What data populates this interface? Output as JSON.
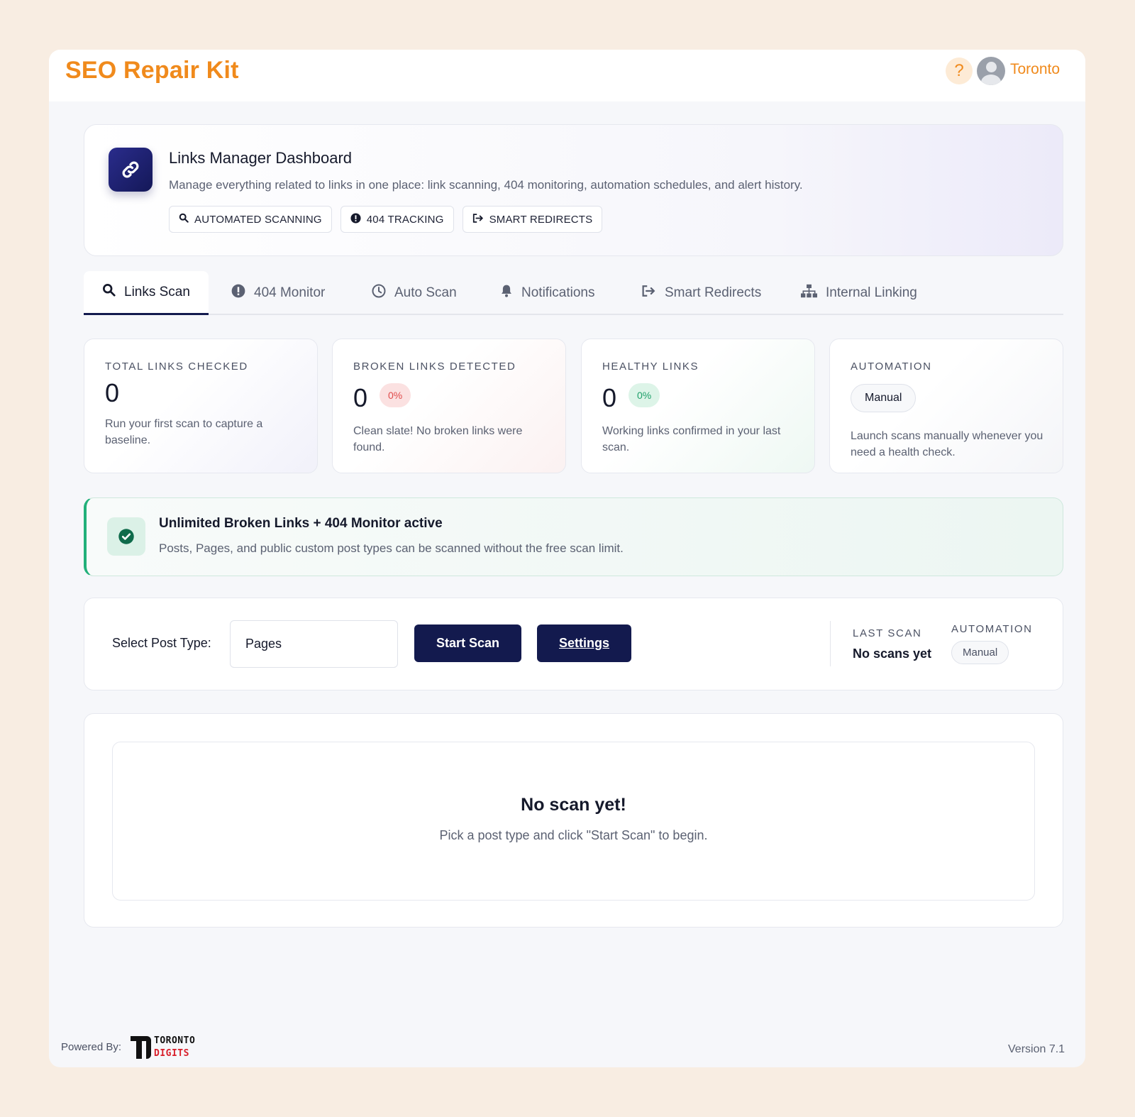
{
  "header": {
    "brand": "SEO Repair Kit",
    "help_label": "?",
    "user_name": "Toronto"
  },
  "hero": {
    "title": "Links Manager Dashboard",
    "description": "Manage everything related to links in one place: link scanning, 404 monitoring, automation schedules, and alert history.",
    "icon": "link-icon",
    "chips": [
      {
        "label": "AUTOMATED SCANNING",
        "icon": "search-icon"
      },
      {
        "label": "404 TRACKING",
        "icon": "alert-circle-icon"
      },
      {
        "label": "SMART REDIRECTS",
        "icon": "redirect-icon"
      }
    ]
  },
  "tabs": [
    {
      "label": "Links Scan",
      "icon": "search-icon",
      "active": true
    },
    {
      "label": "404 Monitor",
      "icon": "alert-circle-icon",
      "active": false
    },
    {
      "label": "Auto Scan",
      "icon": "clock-icon",
      "active": false
    },
    {
      "label": "Notifications",
      "icon": "bell-icon",
      "active": false
    },
    {
      "label": "Smart Redirects",
      "icon": "redirect-icon",
      "active": false
    },
    {
      "label": "Internal Linking",
      "icon": "sitemap-icon",
      "active": false
    }
  ],
  "stats": {
    "total": {
      "label": "TOTAL LINKS CHECKED",
      "value": "0",
      "description": "Run your first scan to capture a baseline."
    },
    "broken": {
      "label": "BROKEN LINKS DETECTED",
      "value": "0",
      "percent": "0%",
      "description": "Clean slate! No broken links were found."
    },
    "healthy": {
      "label": "HEALTHY LINKS",
      "value": "0",
      "percent": "0%",
      "description": "Working links confirmed in your last scan."
    },
    "automation": {
      "label": "AUTOMATION",
      "mode": "Manual",
      "description": "Launch scans manually whenever you need a health check."
    }
  },
  "banner": {
    "title": "Unlimited Broken Links + 404 Monitor active",
    "description": "Posts, Pages, and public custom post types can be scanned without the free scan limit.",
    "icon": "check-circle-icon"
  },
  "controls": {
    "select_label": "Select Post Type:",
    "select_value": "Pages",
    "start_label": "Start Scan",
    "settings_label": "Settings",
    "last_scan_label": "LAST SCAN",
    "last_scan_value": "No scans yet",
    "automation_label": "AUTOMATION",
    "automation_value": "Manual"
  },
  "empty_state": {
    "title": "No scan yet!",
    "description": "Pick a post type and click \"Start Scan\" to begin."
  },
  "footer": {
    "powered_by": "Powered By:",
    "logo_top": "TORONTO",
    "logo_bottom": "DIGITS",
    "version": "Version 7.1"
  },
  "colors": {
    "brand": "#f08a1c",
    "primary": "#131a4e",
    "success": "#22b07a",
    "danger": "#e04b4b",
    "page_background": "#f8ede2"
  }
}
